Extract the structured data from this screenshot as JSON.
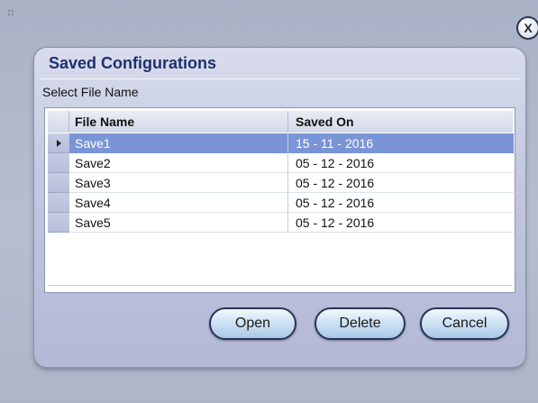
{
  "dialog": {
    "title": "Saved Configurations",
    "close_label": "X",
    "select_label": "Select File Name"
  },
  "table": {
    "columns": [
      "File Name",
      "Saved On"
    ],
    "rows": [
      {
        "name": "Save1",
        "saved_on": "15 - 11 - 2016",
        "selected": true
      },
      {
        "name": "Save2",
        "saved_on": "05 - 12 - 2016",
        "selected": false
      },
      {
        "name": "Save3",
        "saved_on": "05 - 12 - 2016",
        "selected": false
      },
      {
        "name": "Save4",
        "saved_on": "05 - 12 - 2016",
        "selected": false
      },
      {
        "name": "Save5",
        "saved_on": "05 - 12 - 2016",
        "selected": false
      }
    ]
  },
  "buttons": {
    "open": "Open",
    "delete": "Delete",
    "cancel": "Cancel"
  },
  "colors": {
    "selection": "#7a94d6",
    "title": "#1f2f6e",
    "button_border": "#2b3456"
  },
  "icons": {
    "row_pointer": "row-pointer-icon",
    "close": "close-icon",
    "grip": "grip-icon"
  }
}
